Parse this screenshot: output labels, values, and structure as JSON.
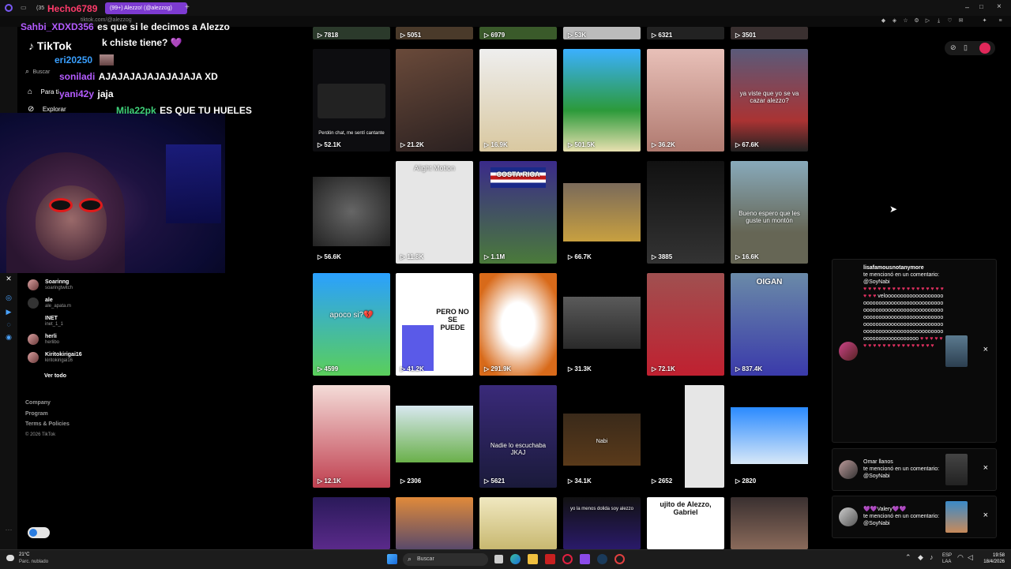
{
  "browser": {
    "tabs": [
      {
        "label": "(35"
      },
      {
        "label": "(99+) Alezzo! (@alezzog)"
      }
    ],
    "new_tab": "+",
    "url": "tiktok.com/@alezzog"
  },
  "sidebar": {
    "logo": "TikTok",
    "search_placeholder": "Buscar",
    "nav": [
      {
        "label": "Para ti"
      },
      {
        "label": "Explorar"
      }
    ],
    "following": [
      {
        "name": "Soarinng",
        "handle": "soaringtwitch"
      },
      {
        "name": "ale",
        "handle": "ale_apata.m"
      },
      {
        "name": "INET",
        "handle": "inet_1_1"
      },
      {
        "name": "herli",
        "handle": "herlibo"
      },
      {
        "name": "Kiritokirigai16",
        "handle": "kiritokirigai16"
      }
    ],
    "see_all": "Ver todo",
    "footer": [
      "Company",
      "Program",
      "Terms & Policies",
      "© 2026 TikTok"
    ]
  },
  "chat": [
    {
      "user": "Sahbi_XDXD356",
      "color": "#b45cff",
      "msg": "es que si le decimos a Alezzo"
    },
    {
      "user": "",
      "color": "#fff",
      "msg": "k chiste tiene? 💜"
    },
    {
      "user": "eri20250",
      "color": "#3aa0ff",
      "msg": ""
    },
    {
      "user": "soniladi",
      "color": "#b45cff",
      "msg": "AJAJAJAJAJAJAJAJA XD"
    },
    {
      "user": "yani42y",
      "color": "#b45cff",
      "msg": "jaja"
    },
    {
      "user": "Mila22pk",
      "color": "#3fd17a",
      "msg": "ES QUE TU HUELES"
    }
  ],
  "chat_header": "Hecho6789",
  "grid": {
    "top_row": [
      "7818",
      "5051",
      "6979",
      "53K",
      "6321",
      "3501"
    ],
    "tiles": [
      {
        "views": "52.1K",
        "caption": "Perdón chat, me sentí cantante"
      },
      {
        "views": "21.2K",
        "caption": ""
      },
      {
        "views": "16.9K",
        "caption": ""
      },
      {
        "views": "501.5K",
        "caption": ""
      },
      {
        "views": "36.2K",
        "caption": ""
      },
      {
        "views": "67.6K",
        "caption": "ya viste que yo se va cazar alezzo?"
      },
      {
        "views": "56.6K",
        "caption": ""
      },
      {
        "views": "11.8K",
        "caption": "Alight Motion"
      },
      {
        "views": "1.1M",
        "caption": "COSTA RICA"
      },
      {
        "views": "66.7K",
        "caption": ""
      },
      {
        "views": "3885",
        "caption": ""
      },
      {
        "views": "16.6K",
        "caption": "Bueno espero que les guste un montón"
      },
      {
        "views": "4599",
        "caption": "apoco si?💔"
      },
      {
        "views": "41.2K",
        "caption": "PERO NO SE PUEDE"
      },
      {
        "views": "291.9K",
        "caption": ""
      },
      {
        "views": "31.3K",
        "caption": ""
      },
      {
        "views": "72.1K",
        "caption": ""
      },
      {
        "views": "837.4K",
        "caption": "OIGAN"
      },
      {
        "views": "12.1K",
        "caption": ""
      },
      {
        "views": "2306",
        "caption": ""
      },
      {
        "views": "5621",
        "caption": "Nadie lo escuchaba JKAJ"
      },
      {
        "views": "34.1K",
        "caption": "Nabi"
      },
      {
        "views": "2652",
        "caption": ""
      },
      {
        "views": "2820",
        "caption": ""
      },
      {
        "views": "",
        "caption": ""
      },
      {
        "views": "",
        "caption": ""
      },
      {
        "views": "",
        "caption": ""
      },
      {
        "views": "",
        "caption": "yo la menos dolida soy alezzo"
      },
      {
        "views": "",
        "caption": "ujito de Alezzo, Gabriel"
      },
      {
        "views": "",
        "caption": ""
      }
    ]
  },
  "notifications": [
    {
      "user": "lisafamousnotanymore",
      "text": "te mencionó en un comentario: @SoyNabi",
      "close": "×"
    },
    {
      "user": "Omar llanos",
      "text": "te mencionó en un comentario: @SoyNabi",
      "close": "×"
    },
    {
      "user": "💜💜Valery💜💜",
      "text": "te mencionó en un comentario: @SoyNabi",
      "close": "×"
    }
  ],
  "taskbar": {
    "weather_temp": "21°C",
    "weather_desc": "Parc. nublado",
    "search": "Buscar",
    "lang": "ESP",
    "lang2": "LAA",
    "time": "19:58",
    "date": "18/4/2026"
  }
}
